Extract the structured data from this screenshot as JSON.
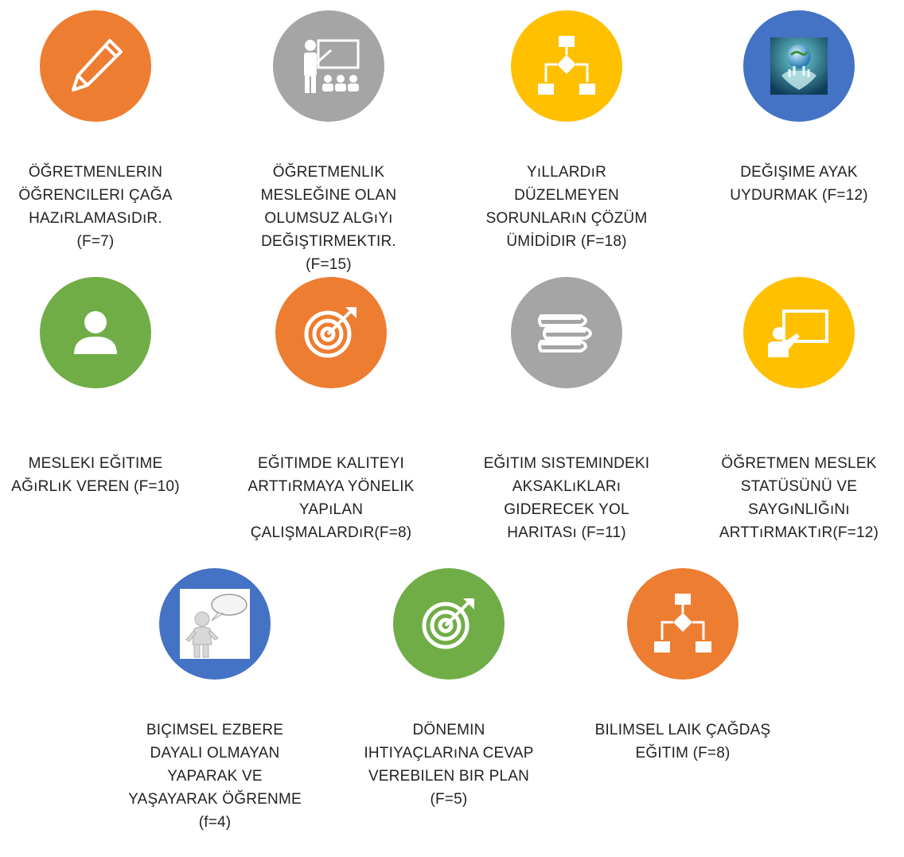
{
  "colors": {
    "orange": "#ED7D31",
    "gray": "#A5A5A5",
    "yellow": "#FFC000",
    "blue": "#4472C4",
    "green": "#70AD47"
  },
  "items": [
    {
      "icon": "pencil-icon",
      "color": "orange",
      "label": "ÖĞRETMENLERIN\nÖĞRENCILERI ÇAĞA\nHAZıRLAMASıDıR.\n(F=7)"
    },
    {
      "icon": "presentation-icon",
      "color": "gray",
      "label": "ÖĞRETMENLIK\nMESLEĞINE OLAN\nOLUMSUZ ALGıYı\nDEĞIŞTIRMEKTIR.\n(F=15)"
    },
    {
      "icon": "flowchart-icon",
      "color": "yellow",
      "label": "YıLLARDıR\nDÜZELMEYEN\nSORUNLARıN ÇÖZÜM\nÜMİDİDIR (F=18)"
    },
    {
      "icon": "globe-hand-image",
      "color": "blue",
      "label": "DEĞIŞIME AYAK\nUYDURMAK (F=12)"
    },
    {
      "icon": "user-icon",
      "color": "green",
      "label": "MESLEKI EĞITIME\nAĞıRLıK VEREN (F=10)"
    },
    {
      "icon": "target-icon",
      "color": "orange",
      "label": "EĞITIMDE KALITEYI\nARTTıRMAYA YÖNELIK\nYAPıLAN\nÇALIŞMALARDıR(F=8)"
    },
    {
      "icon": "books-icon",
      "color": "gray",
      "label": "EĞITIM SISTEMINDEKI\nAKSAKLıKLARı\nGIDERECEK YOL\nHARITASı (F=11)"
    },
    {
      "icon": "teacher-board-icon",
      "color": "yellow",
      "label": "ÖĞRETMEN MESLEK\nSTATÜSÜNÜ VE\nSAYGıNLIĞıNı\nARTTıRMAKTıR(F=12)"
    },
    {
      "icon": "speech-bubble-person-image",
      "color": "blue",
      "label": "BIÇIMSEL EZBERE\nDAYALI OLMAYAN\nYAPARAK VE\nYAŞAYARAK ÖĞRENME\n(f=4)"
    },
    {
      "icon": "target-icon",
      "color": "green",
      "label": "DÖNEMIN\nIHTIYAÇLARıNA CEVAP\nVEREBILEN BIR PLAN\n(F=5)"
    },
    {
      "icon": "flowchart-icon",
      "color": "orange",
      "label": "BILIMSEL LAIK ÇAĞDAŞ\nEĞITIM (F=8)"
    }
  ]
}
